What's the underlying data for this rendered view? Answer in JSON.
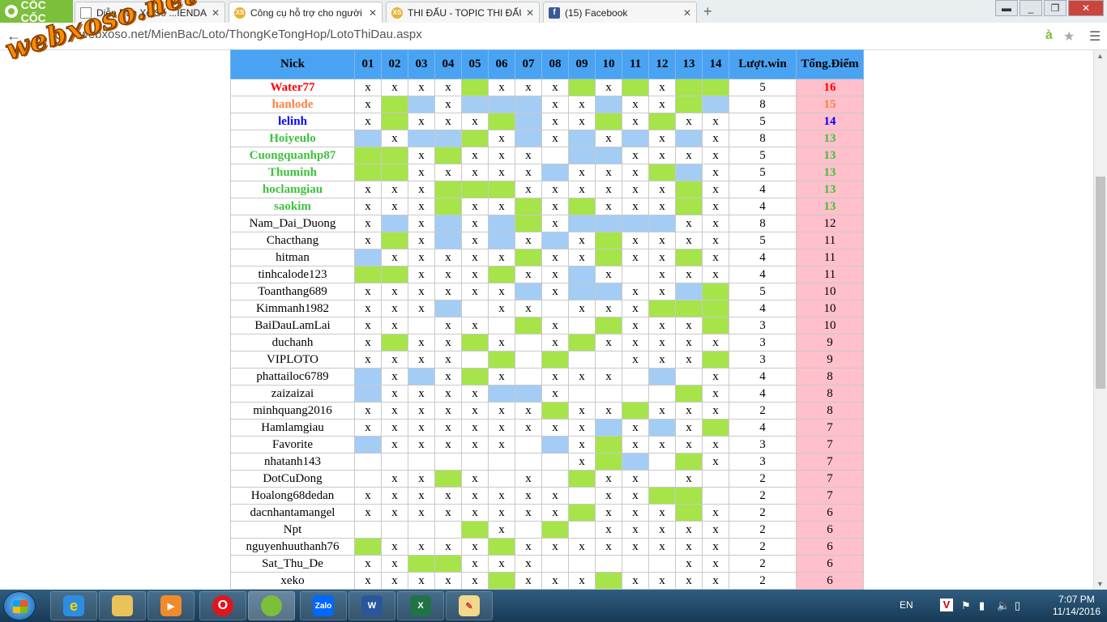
{
  "browser": {
    "brand": "CỐC CỐC",
    "tabs": [
      {
        "label": "Diễn Đàn Xổ Số ...IENDAN...",
        "icon": "document-icon"
      },
      {
        "label": "Công cụ hỗ trợ cho người",
        "icon": "xs-icon"
      },
      {
        "label": "THI ĐẤU - TOPIC THI ĐẤU",
        "icon": "xs-icon"
      },
      {
        "label": "(15) Facebook",
        "icon": "facebook-icon"
      }
    ],
    "url": "webxoso.net/MienBac/Loto/ThongKeTongHop/LotoThiDau.aspx",
    "watermark": "webxoso.net"
  },
  "table": {
    "headers": [
      "Nick",
      "01",
      "02",
      "03",
      "04",
      "05",
      "06",
      "07",
      "08",
      "09",
      "10",
      "11",
      "12",
      "13",
      "14",
      "Lượt.win",
      "Tổng.Điểm"
    ],
    "rows": [
      {
        "nick": "Water77",
        "style": "red",
        "c": [
          "x",
          "x",
          "x",
          "x",
          "g",
          "x",
          "x",
          "x",
          "g",
          "x",
          "g",
          "x",
          "g",
          "g"
        ],
        "win": "5",
        "pts": "16"
      },
      {
        "nick": "hanlode",
        "style": "orange",
        "c": [
          "x",
          "g",
          "b",
          "x",
          "b",
          "b",
          "b",
          "x",
          "x",
          "b",
          "x",
          "x",
          "g",
          "b"
        ],
        "win": "8",
        "pts": "15"
      },
      {
        "nick": "lelinh",
        "style": "blue",
        "c": [
          "x",
          "g",
          "x",
          "x",
          "x",
          "g",
          "b",
          "x",
          "x",
          "g",
          "x",
          "g",
          "x",
          "x"
        ],
        "win": "5",
        "pts": "14"
      },
      {
        "nick": "Hoiyeulo",
        "style": "green",
        "c": [
          "b",
          "x",
          "b",
          "b",
          "g",
          "x",
          "b",
          "x",
          "b",
          "x",
          "b",
          "x",
          "b",
          "x"
        ],
        "win": "8",
        "pts": "13"
      },
      {
        "nick": "Cuongquanhp87",
        "style": "green",
        "c": [
          "g",
          "g",
          "x",
          "g",
          "x",
          "x",
          "x",
          "",
          "b",
          "b",
          "x",
          "x",
          "x",
          "x"
        ],
        "win": "5",
        "pts": "13"
      },
      {
        "nick": "Thuminh",
        "style": "green",
        "c": [
          "g",
          "g",
          "x",
          "x",
          "x",
          "x",
          "x",
          "b",
          "x",
          "x",
          "x",
          "g",
          "b",
          "x"
        ],
        "win": "5",
        "pts": "13"
      },
      {
        "nick": "hoclamgiau",
        "style": "green",
        "c": [
          "x",
          "x",
          "x",
          "g",
          "g",
          "g",
          "x",
          "x",
          "x",
          "x",
          "x",
          "x",
          "g",
          "x"
        ],
        "win": "4",
        "pts": "13"
      },
      {
        "nick": "saokim",
        "style": "green",
        "c": [
          "x",
          "x",
          "x",
          "g",
          "x",
          "x",
          "g",
          "x",
          "g",
          "x",
          "x",
          "x",
          "g",
          "x"
        ],
        "win": "4",
        "pts": "13"
      },
      {
        "nick": "Nam_Dai_Duong",
        "style": "",
        "c": [
          "x",
          "b",
          "x",
          "b",
          "x",
          "b",
          "g",
          "x",
          "b",
          "b",
          "b",
          "b",
          "x",
          "x"
        ],
        "win": "8",
        "pts": "12"
      },
      {
        "nick": "Chacthang",
        "style": "",
        "c": [
          "x",
          "g",
          "x",
          "b",
          "x",
          "b",
          "x",
          "b",
          "x",
          "g",
          "x",
          "x",
          "x",
          "x"
        ],
        "win": "5",
        "pts": "11"
      },
      {
        "nick": "hitman",
        "style": "",
        "c": [
          "b",
          "x",
          "x",
          "x",
          "x",
          "x",
          "g",
          "x",
          "x",
          "g",
          "x",
          "x",
          "g",
          "x"
        ],
        "win": "4",
        "pts": "11"
      },
      {
        "nick": "tinhcalode123",
        "style": "",
        "c": [
          "g",
          "g",
          "x",
          "x",
          "x",
          "g",
          "x",
          "x",
          "b",
          "x",
          "",
          "x",
          "x",
          "x"
        ],
        "win": "4",
        "pts": "11"
      },
      {
        "nick": "Toanthang689",
        "style": "",
        "c": [
          "x",
          "x",
          "x",
          "x",
          "x",
          "x",
          "b",
          "x",
          "b",
          "b",
          "x",
          "x",
          "b",
          "g"
        ],
        "win": "5",
        "pts": "10"
      },
      {
        "nick": "Kimmanh1982",
        "style": "",
        "c": [
          "x",
          "x",
          "x",
          "b",
          "",
          "x",
          "x",
          "",
          "x",
          "x",
          "x",
          "g",
          "g",
          "g"
        ],
        "win": "4",
        "pts": "10"
      },
      {
        "nick": "BaiDauLamLai",
        "style": "",
        "c": [
          "x",
          "x",
          "",
          "x",
          "x",
          "",
          "g",
          "x",
          "",
          "g",
          "x",
          "x",
          "x",
          "g"
        ],
        "win": "3",
        "pts": "10"
      },
      {
        "nick": "duchanh",
        "style": "",
        "c": [
          "x",
          "g",
          "x",
          "x",
          "g",
          "x",
          "",
          "x",
          "g",
          "x",
          "x",
          "x",
          "x",
          "x"
        ],
        "win": "3",
        "pts": "9"
      },
      {
        "nick": "VIPLOTO",
        "style": "",
        "c": [
          "x",
          "x",
          "x",
          "x",
          "",
          "g",
          "",
          "g",
          "",
          "",
          "x",
          "x",
          "x",
          "g"
        ],
        "win": "3",
        "pts": "9"
      },
      {
        "nick": "phattailoc6789",
        "style": "",
        "c": [
          "b",
          "x",
          "b",
          "x",
          "g",
          "x",
          "",
          "x",
          "x",
          "x",
          "",
          "b",
          "",
          "x"
        ],
        "win": "4",
        "pts": "8"
      },
      {
        "nick": "zaizaizai",
        "style": "",
        "c": [
          "b",
          "x",
          "x",
          "x",
          "x",
          "b",
          "b",
          "x",
          "",
          "",
          "",
          "",
          "g",
          "x"
        ],
        "win": "4",
        "pts": "8"
      },
      {
        "nick": "minhquang2016",
        "style": "",
        "c": [
          "x",
          "x",
          "x",
          "x",
          "x",
          "x",
          "x",
          "g",
          "x",
          "x",
          "g",
          "x",
          "x",
          "x"
        ],
        "win": "2",
        "pts": "8"
      },
      {
        "nick": "Hamlamgiau",
        "style": "",
        "c": [
          "x",
          "x",
          "x",
          "x",
          "x",
          "x",
          "x",
          "x",
          "x",
          "b",
          "x",
          "b",
          "x",
          "g"
        ],
        "win": "4",
        "pts": "7"
      },
      {
        "nick": "Favorite",
        "style": "",
        "c": [
          "b",
          "x",
          "x",
          "x",
          "x",
          "x",
          "",
          "b",
          "x",
          "g",
          "x",
          "x",
          "x",
          "x"
        ],
        "win": "3",
        "pts": "7"
      },
      {
        "nick": "nhatanh143",
        "style": "",
        "c": [
          "",
          "",
          "",
          "",
          "",
          "",
          "",
          "",
          "x",
          "g",
          "b",
          "",
          "g",
          "x"
        ],
        "win": "3",
        "pts": "7"
      },
      {
        "nick": "DotCuDong",
        "style": "",
        "c": [
          "",
          "x",
          "x",
          "g",
          "x",
          "",
          "x",
          "",
          "g",
          "x",
          "x",
          "",
          "x",
          ""
        ],
        "win": "2",
        "pts": "7"
      },
      {
        "nick": "Hoalong68dedan",
        "style": "",
        "c": [
          "x",
          "x",
          "x",
          "x",
          "x",
          "x",
          "x",
          "x",
          "",
          "x",
          "x",
          "g",
          "g",
          ""
        ],
        "win": "2",
        "pts": "7"
      },
      {
        "nick": "dacnhantamangel",
        "style": "",
        "c": [
          "x",
          "x",
          "x",
          "x",
          "x",
          "x",
          "x",
          "x",
          "g",
          "x",
          "x",
          "x",
          "g",
          "x"
        ],
        "win": "2",
        "pts": "6"
      },
      {
        "nick": "Npt",
        "style": "",
        "c": [
          "",
          "",
          "",
          "",
          "g",
          "x",
          "",
          "g",
          "",
          "x",
          "x",
          "x",
          "x",
          "x"
        ],
        "win": "2",
        "pts": "6"
      },
      {
        "nick": "nguyenhuuthanh76",
        "style": "",
        "c": [
          "g",
          "x",
          "x",
          "x",
          "x",
          "g",
          "x",
          "x",
          "x",
          "x",
          "x",
          "x",
          "x",
          "x"
        ],
        "win": "2",
        "pts": "6"
      },
      {
        "nick": "Sat_Thu_De",
        "style": "",
        "c": [
          "x",
          "x",
          "g",
          "g",
          "x",
          "x",
          "x",
          "",
          "",
          "",
          "",
          "",
          "x",
          "x"
        ],
        "win": "2",
        "pts": "6"
      },
      {
        "nick": "xeko",
        "style": "",
        "c": [
          "x",
          "x",
          "x",
          "x",
          "x",
          "g",
          "x",
          "x",
          "x",
          "g",
          "x",
          "x",
          "x",
          "x"
        ],
        "win": "2",
        "pts": "6"
      }
    ]
  },
  "taskbar": {
    "apps": [
      "internet-explorer",
      "file-explorer",
      "media-player",
      "opera",
      "coccoc",
      "Zalo",
      "word",
      "excel",
      "paint"
    ],
    "zalo_label": "Zalo",
    "lang": "EN",
    "time": "7:07 PM",
    "date": "11/14/2016"
  }
}
